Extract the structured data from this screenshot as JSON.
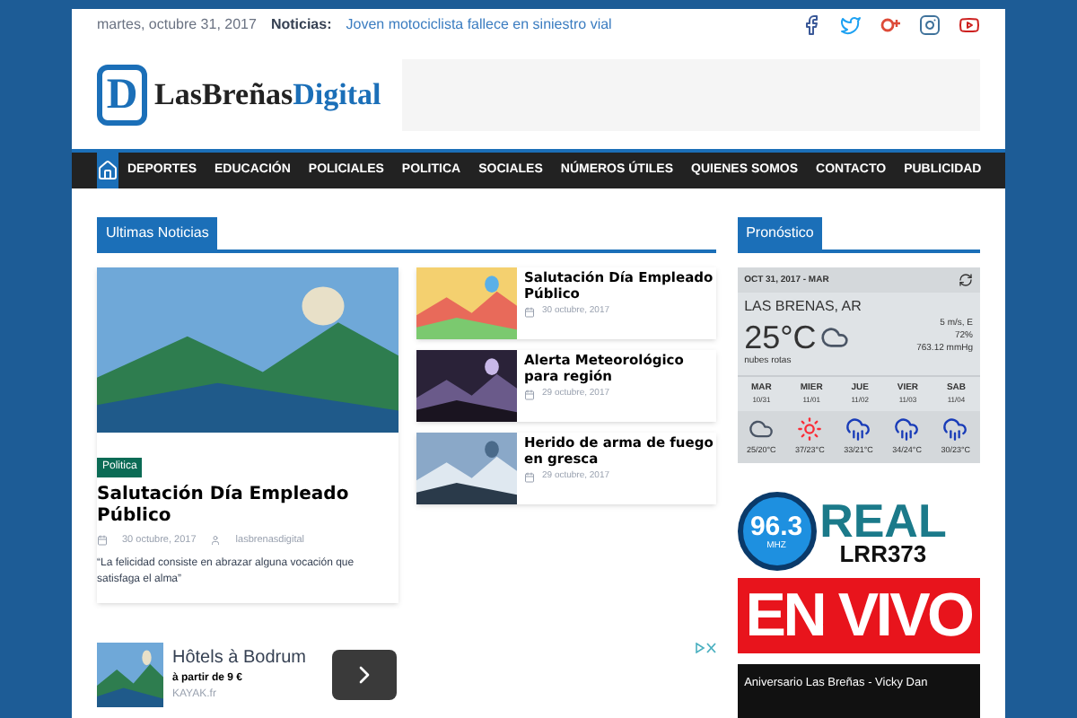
{
  "topbar": {
    "date": "martes, octubre 31, 2017",
    "ticker_label": "Noticias:",
    "ticker_text": "Joven motociclista fallece en siniestro vial"
  },
  "logo": {
    "letter": "D",
    "name": "LasBreñas",
    "accent": "Digital"
  },
  "nav": [
    {
      "label": "DEPORTES",
      "selected": false
    },
    {
      "label": "EDUCACIÓN",
      "selected": false
    },
    {
      "label": "POLICIALES",
      "selected": false
    },
    {
      "label": "POLITICA",
      "selected": false
    },
    {
      "label": "SOCIALES",
      "selected": false
    },
    {
      "label": "NÚMEROS ÚTILES",
      "selected": false
    },
    {
      "label": "QUIENES SOMOS",
      "selected": false
    },
    {
      "label": "CONTACTO",
      "selected": false
    },
    {
      "label": "PUBLICIDAD",
      "selected": false
    }
  ],
  "latest": {
    "heading": "Ultimas Noticias",
    "featured": {
      "tag": "Politica",
      "title": "Salutación Día Empleado Público",
      "date": "30 octubre, 2017",
      "author": "lasbrenasdigital",
      "excerpt": "“La felicidad consiste en abrazar alguna vocación que satisfaga el alma”"
    },
    "items": [
      {
        "title": "Salutación Día Empleado Público",
        "date": "30 octubre, 2017"
      },
      {
        "title": "Alerta Meteorológico para región",
        "date": "29 octubre, 2017"
      },
      {
        "title": "Herido de arma de fuego en gresca",
        "date": "29 octubre, 2017"
      }
    ]
  },
  "forecast": {
    "heading": "Pronóstico",
    "date": "OCT 31, 2017 - MAR",
    "location": "LAS BRENAS, AR",
    "temp": "25°C",
    "condition": "nubes rotas",
    "wind": "5 m/s, E",
    "humidity": "72%",
    "pressure": "763.12 mmHg",
    "days": [
      {
        "day": "MAR",
        "date": "10/31",
        "range": "25/20°C",
        "kind": "cloud"
      },
      {
        "day": "MIER",
        "date": "11/01",
        "range": "37/23°C",
        "kind": "sun"
      },
      {
        "day": "JUE",
        "date": "11/02",
        "range": "33/21°C",
        "kind": "rain"
      },
      {
        "day": "VIER",
        "date": "11/03",
        "range": "34/24°C",
        "kind": "rain"
      },
      {
        "day": "SAB",
        "date": "11/04",
        "range": "30/23°C",
        "kind": "rain"
      }
    ]
  },
  "radio": {
    "freq": "96.3",
    "unit": "MHZ",
    "name": "REAL",
    "call": "LRR373",
    "live": "EN VIVO",
    "video_title": "Aniversario Las Breñas - Vicky Dan"
  },
  "ad": {
    "title": "Hôtels à Bodrum",
    "price": "à partir de 9 €",
    "source": "KAYAK.fr"
  }
}
